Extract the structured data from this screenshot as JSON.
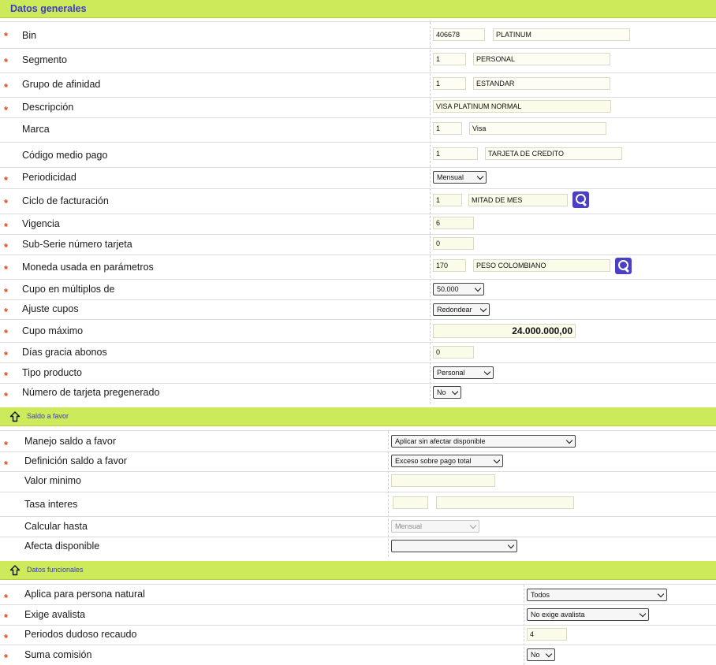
{
  "sections": {
    "general": "Datos generales",
    "balance": "Saldo a favor",
    "functional": "Datos funcionales"
  },
  "icons": {
    "collapse": "arrow-up-icon",
    "search": "search-icon"
  },
  "colors": {
    "section_bg": "#cdea5a",
    "section_text": "#3b3cc4",
    "required": "#e2461a",
    "search_button": "#4b3fc6",
    "input_bg": "#fbfbe9"
  },
  "required_mark": "*",
  "general": {
    "bin": {
      "label": "Bin",
      "code": "406678",
      "name": "PLATINUM"
    },
    "segmento": {
      "label": "Segmento",
      "code": "1",
      "name": "PERSONAL"
    },
    "grupo": {
      "label": "Grupo de afinidad",
      "code": "1",
      "name": "ESTANDAR"
    },
    "descripcion": {
      "label": "Descripción",
      "value": "VISA PLATINUM NORMAL"
    },
    "marca": {
      "label": "Marca",
      "code": "1",
      "name": "Visa"
    },
    "medio_pago": {
      "label": "Código medio pago",
      "code": "1",
      "name": "TARJETA DE CREDITO"
    },
    "periodicidad": {
      "label": "Periodicidad",
      "value": "Mensual"
    },
    "ciclo": {
      "label": "Ciclo de facturación",
      "code": "1",
      "name": "MITAD DE MES"
    },
    "vigencia": {
      "label": "Vigencia",
      "value": "6"
    },
    "subserie": {
      "label": "Sub-Serie número tarjeta",
      "value": "0"
    },
    "moneda": {
      "label": "Moneda usada en parámetros",
      "code": "170",
      "name": "PESO COLOMBIANO"
    },
    "cupo_multiplos": {
      "label": "Cupo en múltiplos de",
      "value": "50.000"
    },
    "ajuste_cupos": {
      "label": "Ajuste cupos",
      "value": "Redondear"
    },
    "cupo_maximo": {
      "label": "Cupo máximo",
      "value": "24.000.000,00"
    },
    "dias_gracia": {
      "label": "Días gracia abonos",
      "value": "0"
    },
    "tipo_producto": {
      "label": "Tipo producto",
      "value": "Personal"
    },
    "pregenerado": {
      "label": "Número de tarjeta pregenerado",
      "value": "No"
    }
  },
  "balance": {
    "manejo": {
      "label": "Manejo saldo a favor",
      "value": "Aplicar sin afectar disponible"
    },
    "definicion": {
      "label": "Definición saldo a favor",
      "value": "Exceso sobre pago total"
    },
    "valor_minimo": {
      "label": "Valor minimo",
      "value": ""
    },
    "tasa": {
      "label": "Tasa interes",
      "code": "",
      "name": ""
    },
    "calcular": {
      "label": "Calcular hasta",
      "value": "Mensual"
    },
    "afecta": {
      "label": "Afecta disponible",
      "value": ""
    }
  },
  "functional": {
    "persona": {
      "label": "Aplica para persona natural",
      "value": "Todos"
    },
    "avalista": {
      "label": "Exige avalista",
      "value": "No exige avalista"
    },
    "dudoso": {
      "label": "Periodos dudoso recaudo",
      "value": "4"
    },
    "comision": {
      "label": "Suma comisión",
      "value": "No"
    }
  }
}
